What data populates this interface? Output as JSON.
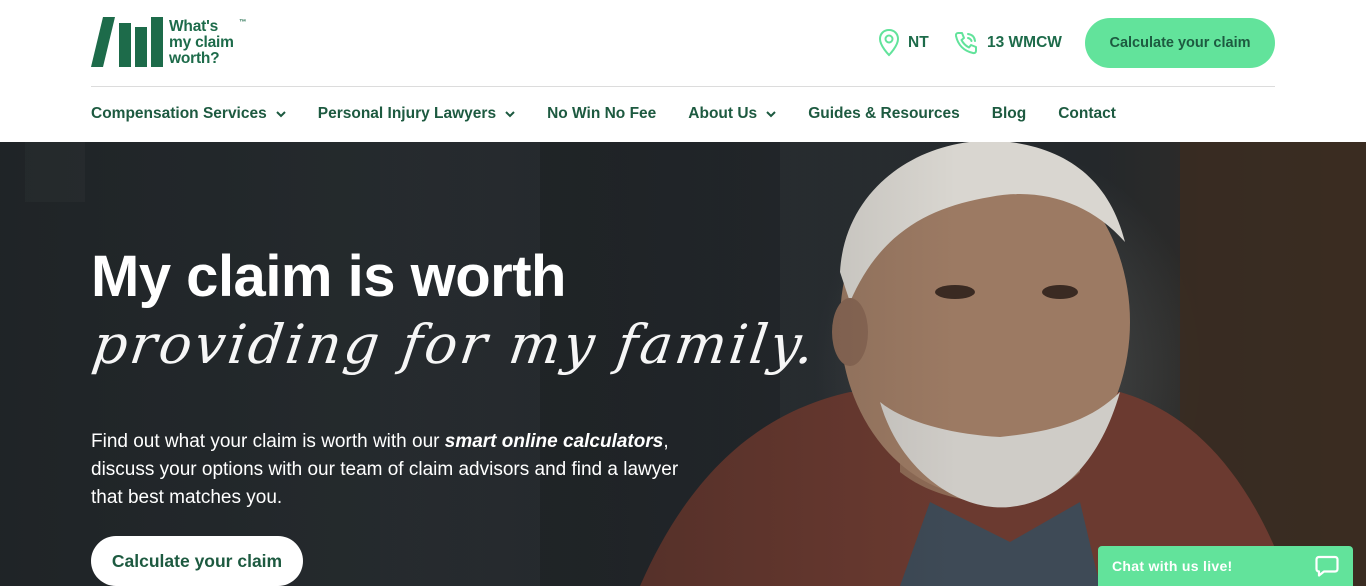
{
  "logo": {
    "line1": "What's",
    "line2": "my claim",
    "line3": "worth?",
    "tm": "™",
    "icon": "logo-bars-icon"
  },
  "header": {
    "location": "NT",
    "location_icon": "map-pin-icon",
    "phone": "13 WMCW",
    "phone_icon": "phone-icon",
    "cta_label": "Calculate your claim"
  },
  "nav": {
    "items": [
      {
        "label": "Compensation Services",
        "has_dropdown": true
      },
      {
        "label": "Personal Injury Lawyers",
        "has_dropdown": true
      },
      {
        "label": "No Win No Fee",
        "has_dropdown": false
      },
      {
        "label": "About Us",
        "has_dropdown": true
      },
      {
        "label": "Guides & Resources",
        "has_dropdown": false
      },
      {
        "label": "Blog",
        "has_dropdown": false
      },
      {
        "label": "Contact",
        "has_dropdown": false
      }
    ]
  },
  "hero": {
    "title": "My claim is worth",
    "script": "providing for my family.",
    "copy_before": "Find out what your claim is worth with our ",
    "copy_emphasis": "smart online calculators",
    "copy_after": ", discuss your options with our team of claim advisors and find a lawyer that best matches you.",
    "cta_label": "Calculate your claim"
  },
  "chat": {
    "label": "Chat with us live!",
    "icon": "chat-bubble-icon"
  },
  "colors": {
    "brand_green": "#1d6b4a",
    "accent_green": "#62e39b",
    "white": "#ffffff"
  }
}
